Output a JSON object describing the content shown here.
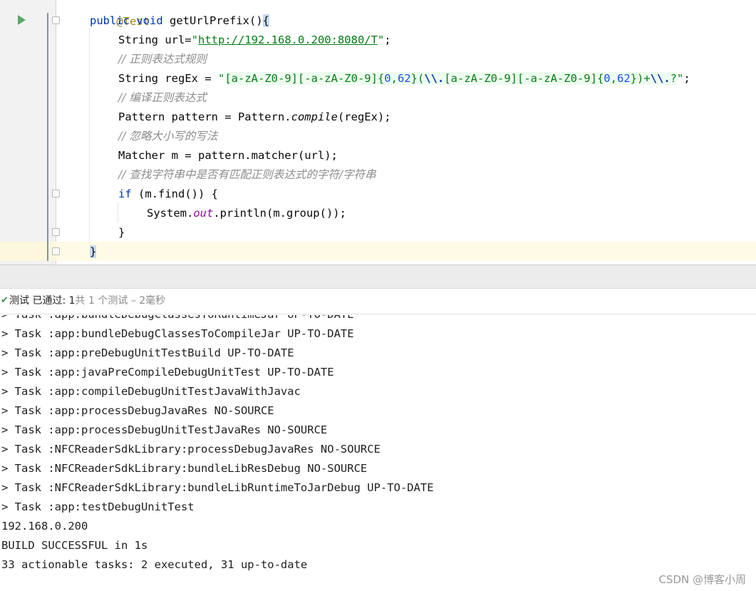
{
  "editor": {
    "lines": {
      "l0": {
        "annotation": "@Test"
      },
      "l1": {
        "kw_public": "public",
        "kw_void": "void",
        "method": " getUrlPrefix()",
        "open_brace": "{"
      },
      "l2": {
        "pre": "String url=",
        "url_open": "\"",
        "url_text": "http://192.168.0.200:8080/T",
        "url_close": "\"",
        "post": ";"
      },
      "l3": {
        "comment": "// 正则表达式规则"
      },
      "l4": {
        "pre": "String regEx = ",
        "q1": "\"",
        "re1": "[a-zA-Z0-9][-a-zA-Z0-9]{",
        "n1": "0",
        "c1": ",",
        "n2": "62",
        "re2": "}(",
        "esc1": "\\\\.",
        "re3": "[a-zA-Z0-9][-a-zA-Z0-9]{",
        "n3": "0",
        "c2": ",",
        "n4": "62",
        "re4": "})+",
        "esc2": "\\\\.",
        "re5": "?",
        "q2": "\"",
        "post": ";"
      },
      "l5": {
        "comment": "// 编译正则表达式"
      },
      "l6": {
        "pre": "Pattern pattern = Pattern.",
        "method": "compile",
        "post": "(regEx);"
      },
      "l7": {
        "comment": "// 忽略大小写的写法"
      },
      "l8": {
        "text": "Matcher m = pattern.matcher(url);"
      },
      "l9": {
        "comment": "// 查找字符串中是否有匹配正则表达式的字符/字符串"
      },
      "l10": {
        "kw_if": "if",
        "rest": " (m.find()) {"
      },
      "l11": {
        "pre": "System.",
        "field": "out",
        "post": ".println(m.group());"
      },
      "l12": {
        "text": "}"
      },
      "l13": {
        "text": "}"
      }
    }
  },
  "status": {
    "main": "测试 已通过: 1",
    "sub": "共 1 个测试 – 2毫秒"
  },
  "console": {
    "lines": [
      "> Task :app:bundleDebugClassesToRuntimeJar UP-TO-DATE",
      "> Task :app:bundleDebugClassesToCompileJar UP-TO-DATE",
      "> Task :app:preDebugUnitTestBuild UP-TO-DATE",
      "> Task :app:javaPreCompileDebugUnitTest UP-TO-DATE",
      "> Task :app:compileDebugUnitTestJavaWithJavac",
      "> Task :app:processDebugJavaRes NO-SOURCE",
      "> Task :app:processDebugUnitTestJavaRes NO-SOURCE",
      "> Task :NFCReaderSdkLibrary:processDebugJavaRes NO-SOURCE",
      "> Task :NFCReaderSdkLibrary:bundleLibResDebug NO-SOURCE",
      "> Task :NFCReaderSdkLibrary:bundleLibRuntimeToJarDebug UP-TO-DATE",
      "> Task :app:testDebugUnitTest",
      "192.168.0.200",
      "BUILD SUCCESSFUL in 1s",
      "33 actionable tasks: 2 executed, 31 up-to-date"
    ]
  },
  "watermark": "CSDN @博客小周",
  "colors": {
    "keyword": "#0033b3",
    "string": "#067d17",
    "comment": "#8c8c8c",
    "field": "#871094",
    "number": "#1750eb",
    "run_icon": "#59a869",
    "pass_check": "#3e8d4a"
  },
  "icons": {
    "run": "run-test-icon",
    "fold": "fold-marker-icon",
    "pass": "test-passed-check-icon"
  }
}
